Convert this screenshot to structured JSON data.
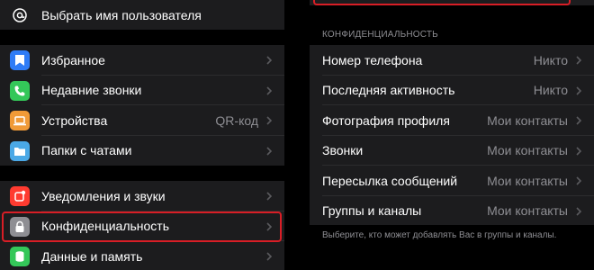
{
  "left": {
    "top_item": {
      "label": "Выбрать имя пользователя",
      "icon": "at-icon"
    },
    "group1": [
      {
        "label": "Избранное",
        "icon": "bookmark-icon",
        "color": "#2f7cf6",
        "value": ""
      },
      {
        "label": "Недавние звонки",
        "icon": "phone-icon",
        "color": "#34c759",
        "value": ""
      },
      {
        "label": "Устройства",
        "icon": "laptop-icon",
        "color": "#f09a37",
        "value": "QR-код"
      },
      {
        "label": "Папки с чатами",
        "icon": "folder-icon",
        "color": "#4aa8e6",
        "value": ""
      }
    ],
    "group2": [
      {
        "label": "Уведомления и звуки",
        "icon": "bell-icon",
        "color": "#ff3b30",
        "value": ""
      },
      {
        "label": "Конфиденциальность",
        "icon": "lock-icon",
        "color": "#8e8e93",
        "value": ""
      },
      {
        "label": "Данные и память",
        "icon": "database-icon",
        "color": "#34c759",
        "value": ""
      }
    ]
  },
  "right": {
    "section_header": "КОНФИДЕНЦИАЛЬНОСТЬ",
    "items": [
      {
        "label": "Номер телефона",
        "value": "Никто"
      },
      {
        "label": "Последняя активность",
        "value": "Никто"
      },
      {
        "label": "Фотография профиля",
        "value": "Мои контакты"
      },
      {
        "label": "Звонки",
        "value": "Мои контакты"
      },
      {
        "label": "Пересылка сообщений",
        "value": "Мои контакты"
      },
      {
        "label": "Группы и каналы",
        "value": "Мои контакты"
      }
    ],
    "footer_note": "Выберите, кто может добавлять Вас в группы и каналы."
  },
  "colors": {
    "highlight": "#d81e26",
    "cell_bg": "#1c1c1e",
    "secondary_text": "#8e8e93"
  }
}
